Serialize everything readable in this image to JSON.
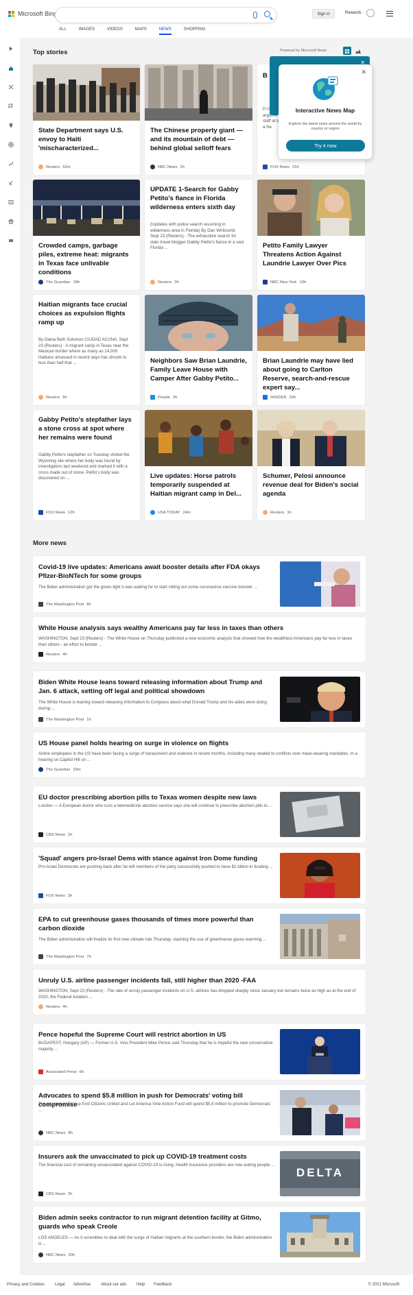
{
  "header": {
    "brand": "Microsoft Bing",
    "signin": "Sign in",
    "rewards": "Rewards",
    "tabs": [
      "ALL",
      "IMAGES",
      "VIDEOS",
      "MAPS",
      "NEWS",
      "SHOPPING"
    ],
    "active_tab": "NEWS"
  },
  "top": {
    "section_title": "Top stories",
    "powered": "Powered by Microsoft News"
  },
  "popup": {
    "title": "Interactive News Map",
    "desc": "Explore the latest news around the world by country or region",
    "button": "Try it now"
  },
  "cards": [
    {
      "title": "State Department says U.S. envoy to Haiti 'mischaracterized...",
      "source": "Reuters",
      "time": "52m",
      "desc": ""
    },
    {
      "title": "The Chinese property giant — and its mountain of debt — behind global selloff fears",
      "source": "NBC News",
      "time": "2h",
      "desc": ""
    },
    {
      "title": "B",
      "source": "FOX News",
      "time": "21h",
      "desc": "Fi Petito argume staff at to a Ne"
    },
    {
      "title": "Crowded camps, garbage piles, extreme heat: migrants in Texas face unlivable conditions",
      "source": "The Guardian",
      "time": "19h",
      "desc": ""
    },
    {
      "title": "UPDATE 1-Search for Gabby Petito's fiance in Florida wilderness enters sixth day",
      "source": "Reuters",
      "time": "2h",
      "desc": "(Updates with police search resuming in wilderness area in Florida) By Dan Whitcomb Sept 23 (Reuters) - The exhaustive search for slain travel blogger Gabby Petito's fiance in a vast Florida ..."
    },
    {
      "title": "Petito Family Lawyer Threatens Action Against Laundrie Lawyer Over Pics",
      "source": "NBC New York",
      "time": "10h",
      "desc": ""
    },
    {
      "title": "Haitian migrants face crucial choices as expulsion flights ramp up",
      "source": "Reuters",
      "time": "5h",
      "desc": "By Daina Beth Solomon CIUDAD ACUNA, Sept 23 (Reuters) - A migrant camp in Texas near the Mexican border where as many as 14,000 Haitians amassed in recent days has shrunk to less than half that ..."
    },
    {
      "title": "Neighbors Saw Brian Laundrie, Family Leave House with Camper After Gabby Petito...",
      "source": "People",
      "time": "2h",
      "desc": ""
    },
    {
      "title": "Brian Laundrie may have lied about going to Carlton Reserve, search-and-rescue expert say...",
      "source": "INSIDER",
      "time": "20h",
      "desc": ""
    },
    {
      "title": "Gabby Petito's stepfather lays a stone cross at spot where her remains were found",
      "source": "FOX News",
      "time": "12h",
      "desc": "Gabby Petito's stepfather on Tuesday visited the Wyoming site where her body was found by investigators last weekend and marked it with a cross made out of stone. Petito's body was discovered on ..."
    },
    {
      "title": "Live updates: Horse patrols temporarily suspended at Haitian migrant camp in Del...",
      "source": "USA TODAY",
      "time": "24m",
      "desc": ""
    },
    {
      "title": "Schumer, Pelosi announce revenue deal for Biden's social agenda",
      "source": "Reuters",
      "time": "1h",
      "desc": ""
    }
  ],
  "more": {
    "section_title": "More news",
    "items": [
      {
        "title": "Covid-19 live updates: Americans await booster details after FDA okays Pfizer-BioNTech for some groups",
        "desc": "The Biden administration got the green light it was waiting for to start rolling out some coronavirus vaccine booster ...",
        "source": "The Washington Post",
        "time": "8h"
      },
      {
        "title": "White House analysis says wealthy Americans pay far less in taxes than others",
        "desc": "WASHINGTON, Sept 23 (Reuters) - The White House on Thursday published a new economic analysis that showed how the wealthiest Americans pay far less in taxes than others - an effort to bolster ...",
        "source": "Reuters",
        "time": "4h"
      },
      {
        "title": "Biden White House leans toward releasing information about Trump and Jan. 6 attack, setting off legal and political showdown",
        "desc": "The White House is leaning toward releasing information to Congress about what Donald Trump and his aides were doing during ...",
        "source": "The Washington Post",
        "time": "1h"
      },
      {
        "title": "US House panel holds hearing on surge in violence on flights",
        "desc": "Airline employees in the US have been facing a surge of harassment and violence in recent months, including many related to conflicts over mask-wearing mandates. In a hearing on Capitol Hill on ...",
        "source": "The Guardian",
        "time": "33m"
      },
      {
        "title": "EU doctor prescribing abortion pills to Texas women despite new laws",
        "desc": "London — A European doctor who runs a telemedicine abortion service says she will continue to prescribe abortion pills to ...",
        "source": "CBS News",
        "time": "2h"
      },
      {
        "title": "'Squad' angers pro-Israel Dems with stance against Iron Dome funding",
        "desc": "Pro-Israel Democrats are pushing back after far-left members of the party successfully pushed to have $1 billion in funding ...",
        "source": "FOX News",
        "time": "3h"
      },
      {
        "title": "EPA to cut greenhouse gases thousands of times more powerful than carbon dioxide",
        "desc": "The Biden administration will finalize its first new climate rule Thursday, slashing the use of greenhouse gases warming ...",
        "source": "The Washington Post",
        "time": "7h"
      },
      {
        "title": "Unruly U.S. airline passenger incidents fall, still higher than 2020 -FAA",
        "desc": "WASHINGTON, Sept 23 (Reuters) - The rate of unruly passenger incidents on U.S. airlines has dropped sharply since January but remains twice as high as at the end of 2020, the Federal Aviation ...",
        "source": "Reuters",
        "time": "4h"
      },
      {
        "title": "Pence hopeful the Supreme Court will restrict abortion in US",
        "desc": "BUDAPEST, Hungary (AP) — Former U.S. Vice President Mike Pence said Thursday that he is hopeful the new conservative majority ...",
        "source": "Associated Press",
        "time": "6h"
      },
      {
        "title": "Advocates to spend $5.8 million in push for Democrats' voting bill compromise",
        "desc": "The progressive group End Citizens United and Let America Vote Action Fund will spend $5.8 million to promote Democrats' ...",
        "source": "NBC News",
        "time": "8h"
      },
      {
        "title": "Insurers ask the unvaccinated to pick up COVID-19 treatment costs",
        "desc": "The financial cost of remaining unvaccinated against COVID-19 is rising. Health insurance providers are now asking people ...",
        "source": "CBS News",
        "time": "2h"
      },
      {
        "title": "Biden admin seeks contractor to run migrant detention facility at Gitmo, guards who speak Creole",
        "desc": "LOS ANGELES — As it scrambles to deal with the surge of Haitian migrants at the southern border, the Biden administration is ...",
        "source": "NBC News",
        "time": "20h"
      }
    ]
  },
  "delta_text": "DELTA",
  "footer": {
    "links": [
      "Privacy and Cookies",
      "Legal",
      "Advertise",
      "About our ads",
      "Help",
      "Feedback"
    ],
    "copyright": "© 2021 Microsoft"
  }
}
